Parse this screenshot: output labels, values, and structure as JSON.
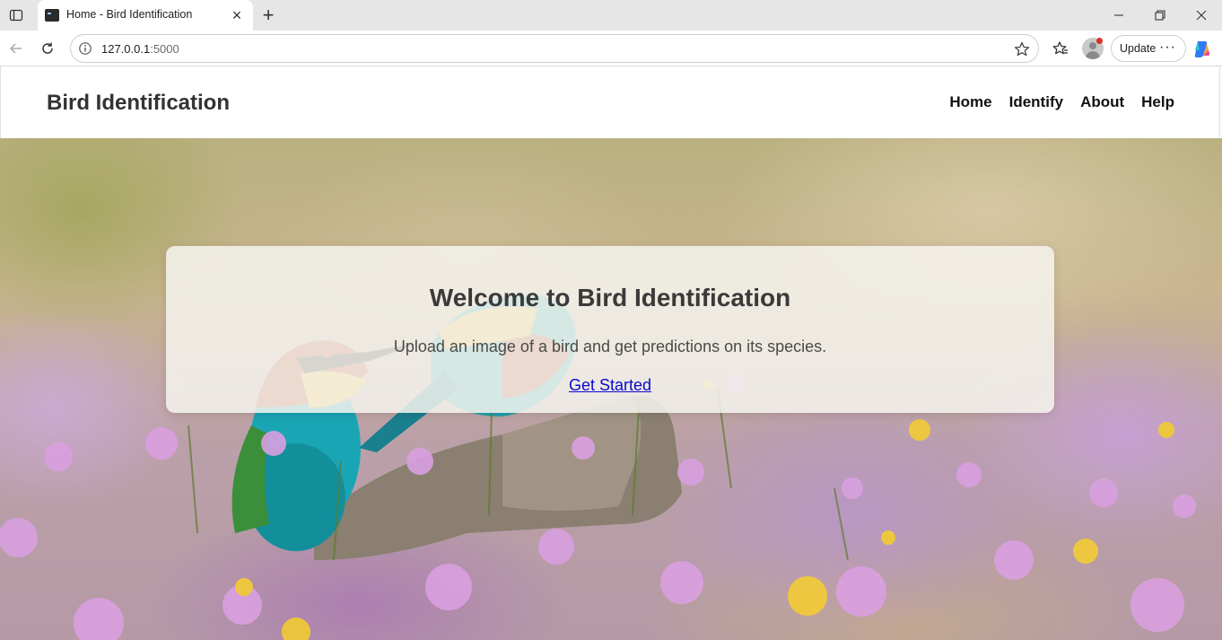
{
  "browser": {
    "tab_title": "Home - Bird Identification",
    "url_host": "127.0.0.1",
    "url_port": ":5000",
    "update_label": "Update",
    "more_label": "···",
    "new_tab_label": "+",
    "close_tab_label": "×"
  },
  "site": {
    "brand": "Bird Identification",
    "nav": [
      "Home",
      "Identify",
      "About",
      "Help"
    ]
  },
  "hero": {
    "heading": "Welcome to Bird Identification",
    "subtitle": "Upload an image of a bird and get predictions on its species.",
    "cta_label": "Get Started",
    "background_image": "bee-eater birds on a log in a field of pink wildflowers"
  },
  "colors": {
    "link": "#0a0ad0",
    "heading_text": "#3a3a3a",
    "tabbar_bg": "#e6e6e6"
  }
}
